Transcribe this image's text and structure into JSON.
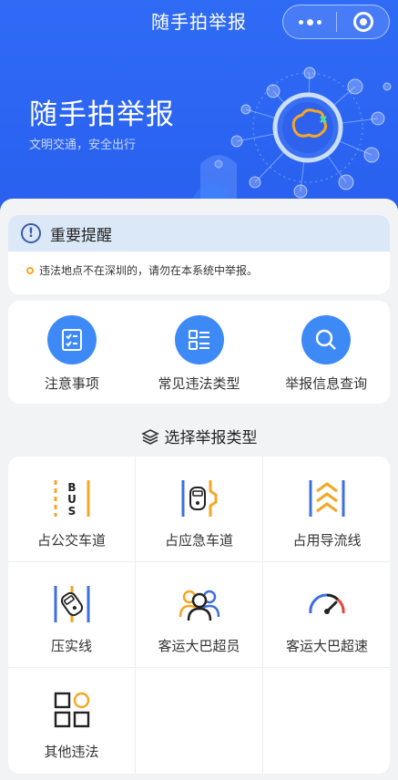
{
  "nav": {
    "title": "随手拍举报"
  },
  "hero": {
    "title": "随手拍举报",
    "subtitle": "文明交通，安全出行"
  },
  "notice": {
    "title": "重要提醒",
    "text": "违法地点不在深圳的，请勿在本系统中举报。"
  },
  "quick_actions": [
    {
      "label": "注意事项",
      "icon": "checklist-icon"
    },
    {
      "label": "常见违法类型",
      "icon": "list-icon"
    },
    {
      "label": "举报信息查询",
      "icon": "search-icon"
    }
  ],
  "section": {
    "title": "选择举报类型",
    "icon": "layers-icon"
  },
  "report_types": [
    {
      "label": "占公交车道",
      "icon": "bus-lane-icon"
    },
    {
      "label": "占应急车道",
      "icon": "emergency-lane-icon"
    },
    {
      "label": "占用导流线",
      "icon": "diversion-line-icon"
    },
    {
      "label": "压实线",
      "icon": "solid-line-icon"
    },
    {
      "label": "客运大巴超员",
      "icon": "overload-passengers-icon"
    },
    {
      "label": "客运大巴超速",
      "icon": "speedometer-icon"
    },
    {
      "label": "其他违法",
      "icon": "grid-apps-icon"
    }
  ],
  "colors": {
    "primary": "#2b64f2",
    "accent": "#f5a623",
    "icon_blue": "#3d8af7"
  }
}
